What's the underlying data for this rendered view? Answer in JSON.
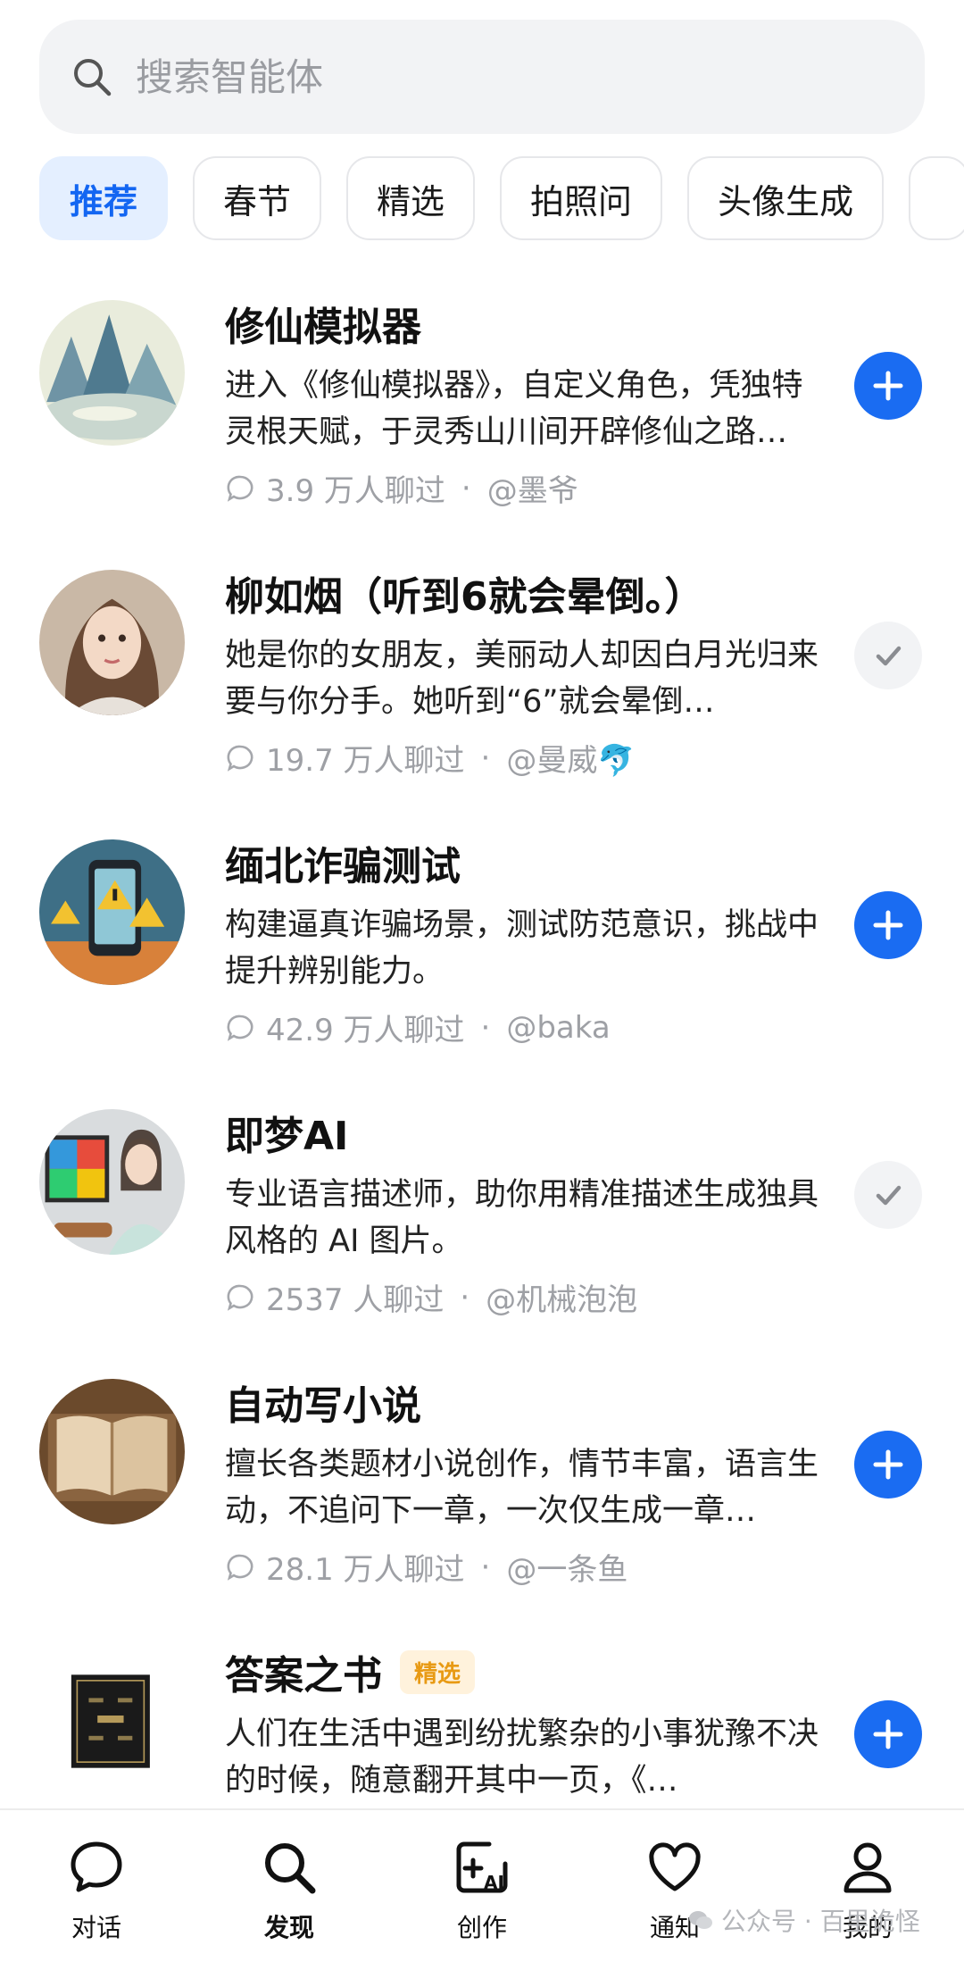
{
  "search": {
    "placeholder": "搜索智能体"
  },
  "chips": [
    {
      "label": "推荐",
      "active": true
    },
    {
      "label": "春节"
    },
    {
      "label": "精选"
    },
    {
      "label": "拍照问"
    },
    {
      "label": "头像生成"
    }
  ],
  "agents": [
    {
      "title": "修仙模拟器",
      "desc": "进入《修仙模拟器》，自定义角色，凭独特灵根天赋，于灵秀山川间开辟修仙之路…",
      "count": "3.9 万人聊过",
      "author": "@墨爷",
      "action_state": "add",
      "action_icon": "plus-icon",
      "avatar_icon": "landscape-avatar"
    },
    {
      "title": "柳如烟（听到6就会晕倒。）",
      "desc": "她是你的女朋友，美丽动人却因白月光归来要与你分手。她听到“6”就会晕倒…",
      "count": "19.7 万人聊过",
      "author": "@曼威🐬",
      "action_state": "added",
      "action_icon": "check-icon",
      "avatar_icon": "woman-portrait-avatar"
    },
    {
      "title": "缅北诈骗测试",
      "desc": "构建逼真诈骗场景，测试防范意识，挑战中提升辨别能力。",
      "count": "42.9 万人聊过",
      "author": "@baka",
      "action_state": "add",
      "action_icon": "plus-icon",
      "avatar_icon": "phone-warning-avatar"
    },
    {
      "title": "即梦AI",
      "desc": "专业语言描述师，助你用精准描述生成独具风格的 AI 图片。",
      "count": "2537 人聊过",
      "author": "@机械泡泡",
      "action_state": "added",
      "action_icon": "check-icon",
      "avatar_icon": "painter-avatar"
    },
    {
      "title": "自动写小说",
      "desc": "擅长各类题材小说创作，情节丰富，语言生动，不追问下一章，一次仅生成一章…",
      "count": "28.1 万人聊过",
      "author": "@一条鱼",
      "action_state": "add",
      "action_icon": "plus-icon",
      "avatar_icon": "open-book-avatar"
    },
    {
      "title": "答案之书",
      "badge": "精选",
      "desc": "人们在生活中遇到纷扰繁杂的小事犹豫不决的时候，随意翻开其中一页，《…",
      "count": "",
      "author": "",
      "action_state": "add",
      "action_icon": "plus-icon",
      "avatar_icon": "black-book-avatar"
    }
  ],
  "nav": [
    {
      "label": "对话",
      "icon": "chat-bubble-icon"
    },
    {
      "label": "发现",
      "icon": "search-icon",
      "active": true
    },
    {
      "label": "创作",
      "icon": "create-ai-icon"
    },
    {
      "label": "通知",
      "icon": "heart-icon"
    },
    {
      "label": "我的",
      "icon": "profile-icon"
    }
  ],
  "watermark": "公众号 · 百里诡怪",
  "colors": {
    "accent": "#1a6cf2",
    "chip_active_bg": "#e4efff",
    "badge_bg": "#fff2dc",
    "badge_text": "#e89a14"
  }
}
